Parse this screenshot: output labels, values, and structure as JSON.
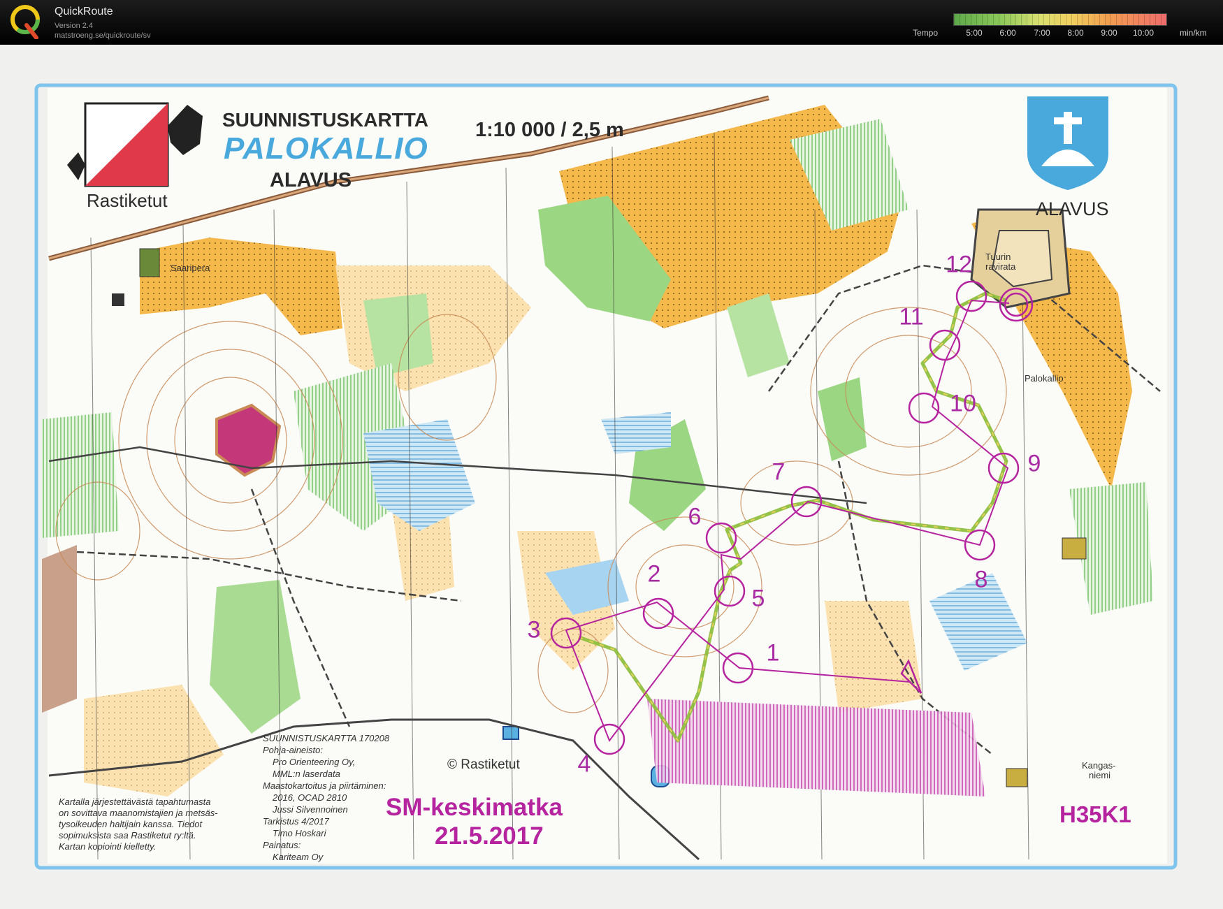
{
  "app": {
    "name": "QuickRoute",
    "version": "Version 2.4",
    "url": "matstroeng.se/quickroute/sv"
  },
  "tempo": {
    "label": "Tempo",
    "ticks": [
      "5:00",
      "6:00",
      "7:00",
      "8:00",
      "9:00",
      "10:00"
    ],
    "unit": "min/km"
  },
  "map": {
    "header": "SUUNNISTUSKARTTA",
    "name": "PALOKALLIO",
    "municipality": "ALAVUS",
    "scale": "1:10 000 / 2,5 m",
    "club": "Rastiketut",
    "crest_label": "ALAVUS",
    "places": {
      "saaripera": "Saaripera",
      "tuurin_1": "Tuurin",
      "tuurin_2": "ravirata",
      "palokallio": "Palokallio",
      "kangas_1": "Kangas-",
      "kangas_2": "niemi"
    },
    "copyright": "© Rastiketut",
    "credits": [
      "SUUNNISTUSKARTTA 170208",
      "Pohja-aineisto:",
      "Pro Orienteering Oy,",
      "MML:n laserdata",
      "Maastokartoitus ja piirtäminen:",
      "2016, OCAD 2810",
      "Jussi Silvennoinen",
      "Tarkistus 4/2017",
      "Timo Hoskari",
      "Painatus:",
      "Kariteam Oy"
    ],
    "legal": [
      "Kartalla järjestettävästä tapahtumasta",
      "on sovittava maanomistajien ja metsäs-",
      "tysoikeuden haltijain kanssa. Tiedot",
      "sopimuksista saa Rastiketut ry:ltä.",
      "Kartan kopiointi kielletty."
    ],
    "event_name": "SM-keskimatka",
    "event_date": "21.5.2017",
    "course": "H35K1"
  },
  "course": {
    "controls": [
      {
        "label": "1"
      },
      {
        "label": "2"
      },
      {
        "label": "3"
      },
      {
        "label": "4"
      },
      {
        "label": "5"
      },
      {
        "label": "6"
      },
      {
        "label": "7"
      },
      {
        "label": "8"
      },
      {
        "label": "9"
      },
      {
        "label": "10"
      },
      {
        "label": "11"
      },
      {
        "label": "12"
      }
    ]
  },
  "colors": {
    "course": "#b5249e",
    "route": "#8fbf3e",
    "forest_open": "#f5b84a",
    "vegetation": "#7cc86a",
    "water": "#9fd0ee",
    "contour": "#c98a55"
  }
}
